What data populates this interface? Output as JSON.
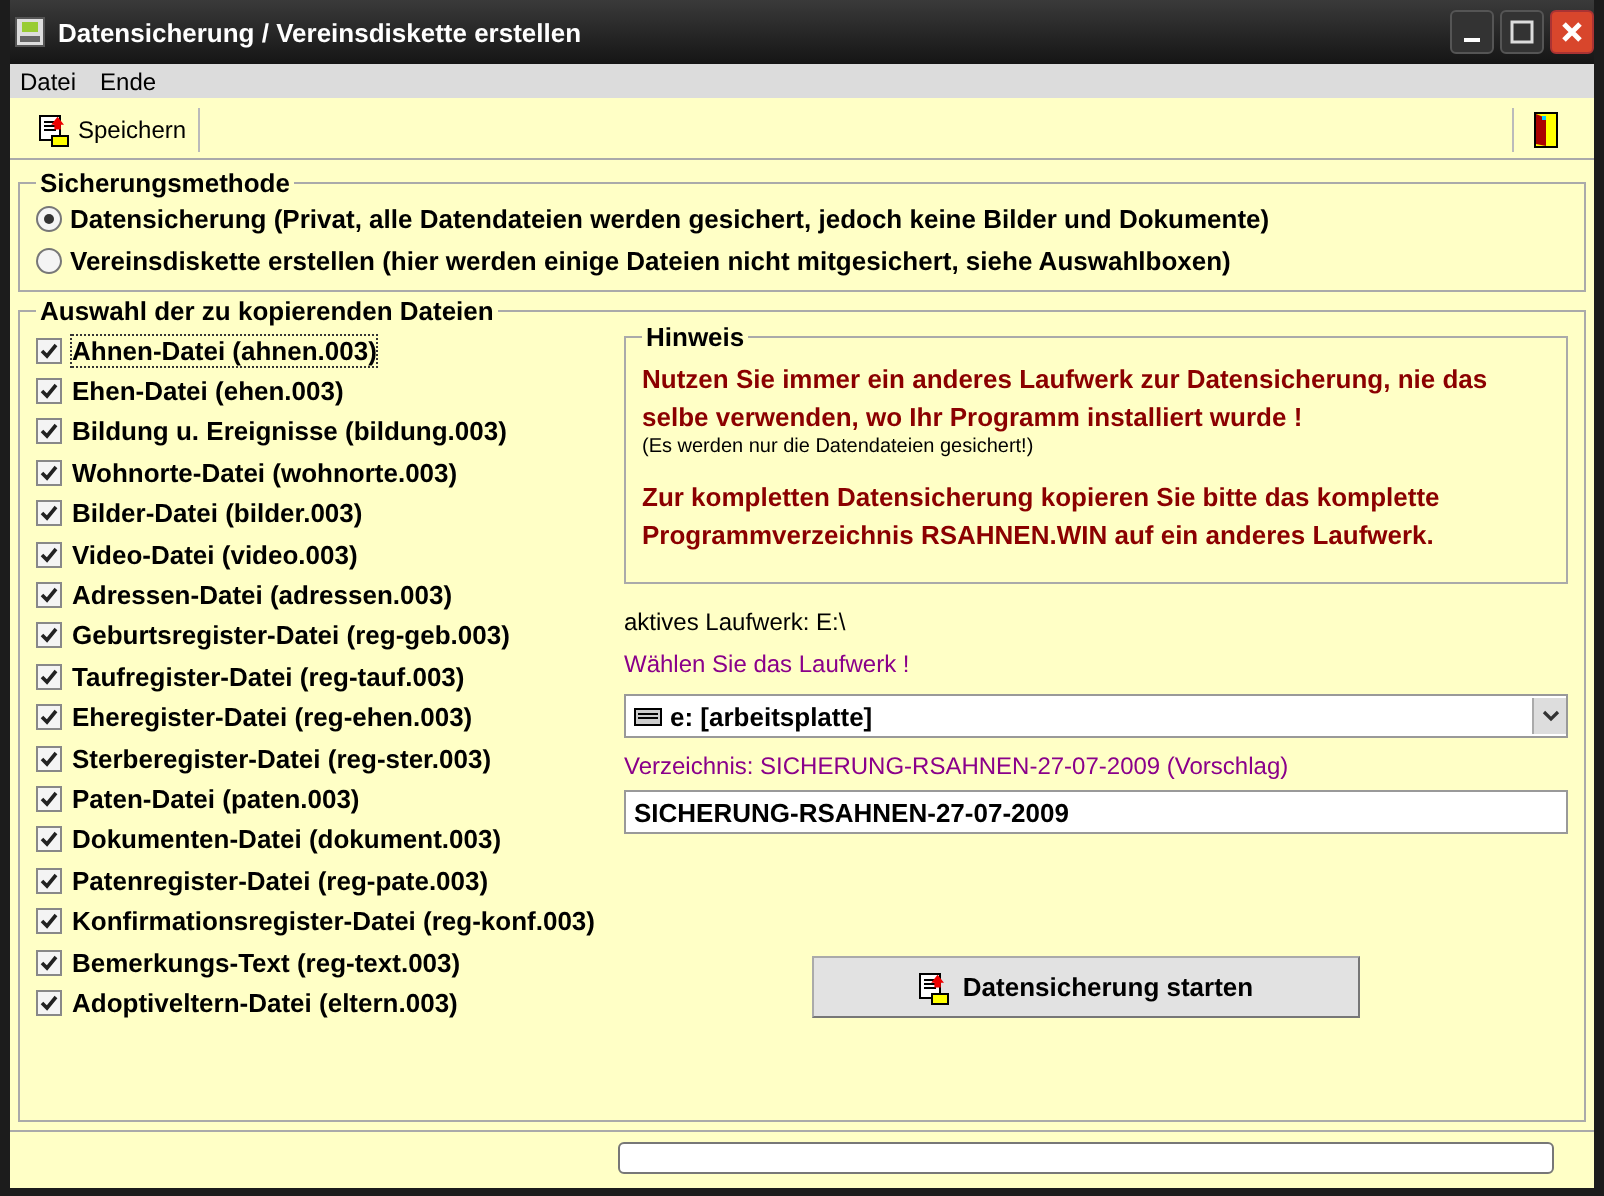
{
  "window": {
    "title": "Datensicherung / Vereinsdiskette erstellen"
  },
  "menu": [
    "Datei",
    "Ende"
  ],
  "toolbar": {
    "save_label": "Speichern"
  },
  "method": {
    "title": "Sicherungsmethode",
    "options": [
      {
        "label": "Datensicherung (Privat, alle Datendateien werden gesichert, jedoch keine Bilder und Dokumente)",
        "selected": true
      },
      {
        "label": "Vereinsdiskette erstellen (hier werden einige Dateien nicht mitgesichert, siehe Auswahlboxen)",
        "selected": false
      }
    ]
  },
  "files": {
    "title": "Auswahl der zu kopierenden Dateien",
    "items": [
      {
        "label": "Ahnen-Datei (ahnen.003)",
        "checked": true,
        "focused": true
      },
      {
        "label": "Ehen-Datei (ehen.003)",
        "checked": true,
        "focused": false
      },
      {
        "label": "Bildung u. Ereignisse (bildung.003)",
        "checked": true,
        "focused": false
      },
      {
        "label": "Wohnorte-Datei (wohnorte.003)",
        "checked": true,
        "focused": false
      },
      {
        "label": "Bilder-Datei (bilder.003)",
        "checked": true,
        "focused": false
      },
      {
        "label": "Video-Datei (video.003)",
        "checked": true,
        "focused": false
      },
      {
        "label": "Adressen-Datei (adressen.003)",
        "checked": true,
        "focused": false
      },
      {
        "label": "Geburtsregister-Datei (reg-geb.003)",
        "checked": true,
        "focused": false
      },
      {
        "label": "Taufregister-Datei (reg-tauf.003)",
        "checked": true,
        "focused": false
      },
      {
        "label": "Eheregister-Datei (reg-ehen.003)",
        "checked": true,
        "focused": false
      },
      {
        "label": "Sterberegister-Datei (reg-ster.003)",
        "checked": true,
        "focused": false
      },
      {
        "label": "Paten-Datei (paten.003)",
        "checked": true,
        "focused": false
      },
      {
        "label": "Dokumenten-Datei (dokument.003)",
        "checked": true,
        "focused": false
      },
      {
        "label": "Patenregister-Datei (reg-pate.003)",
        "checked": true,
        "focused": false
      },
      {
        "label": "Konfirmationsregister-Datei (reg-konf.003)",
        "checked": true,
        "focused": false
      },
      {
        "label": "Bemerkungs-Text (reg-text.003)",
        "checked": true,
        "focused": false
      },
      {
        "label": "Adoptiveltern-Datei (eltern.003)",
        "checked": true,
        "focused": false
      }
    ]
  },
  "hint": {
    "title": "Hinweis",
    "warning": "Nutzen Sie immer ein anderes Laufwerk zur Datensicherung, nie das selbe verwenden, wo Ihr Programm installiert wurde !",
    "note": "(Es werden nur die Datendateien gesichert!)",
    "advice": "Zur kompletten Datensicherung kopieren Sie bitte das komplette Programmverzeichnis RSAHNEN.WIN auf ein anderes Laufwerk."
  },
  "active_drive": "aktives Laufwerk: E:\\",
  "drive_prompt": "Wählen Sie das Laufwerk !",
  "drive_select": "e: [arbeitsplatte]",
  "directory_label": "Verzeichnis: SICHERUNG-RSAHNEN-27-07-2009 (Vorschlag)",
  "directory_value": "SICHERUNG-RSAHNEN-27-07-2009",
  "start_button": "Datensicherung starten",
  "status_bar": {
    "progress": {
      "level": 0
    }
  }
}
